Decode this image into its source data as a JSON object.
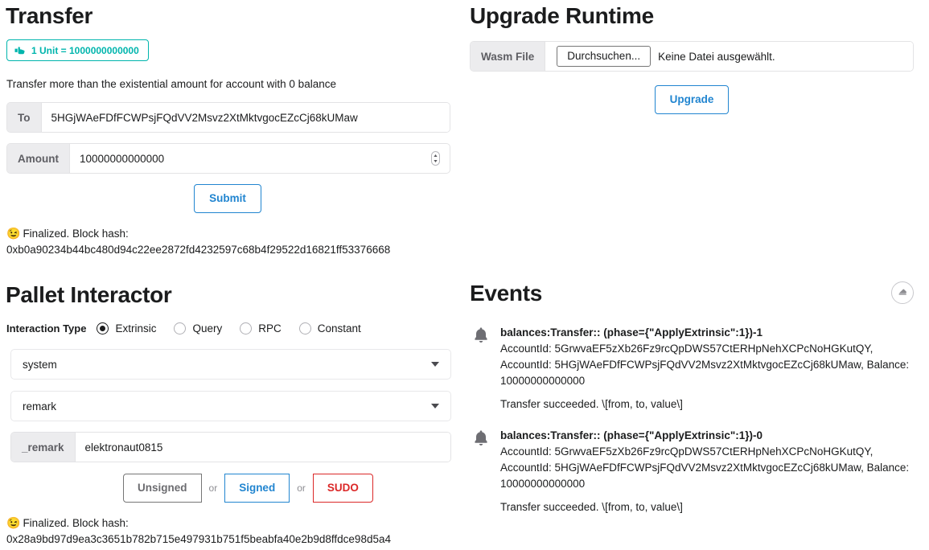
{
  "transfer": {
    "title": "Transfer",
    "unit_badge": {
      "icon": "pointing-hand-icon",
      "label": "1 Unit = 1000000000000",
      "color": "#00b5ad"
    },
    "helper_text": "Transfer more than the existential amount for account with 0 balance",
    "to_label": "To",
    "to_value": "5HGjWAeFDfFCWPsjFQdVV2Msvz2XtMktvgocEZcCj68kUMaw",
    "amount_label": "Amount",
    "amount_value": "10000000000000",
    "submit_label": "Submit",
    "status_emoji": "😉",
    "status_text": "Finalized. Block hash:",
    "status_hash": "0xb0a90234b44bc480d94c22ee2872fd4232597c68b4f29522d16821ff53376668"
  },
  "upgrade": {
    "title": "Upgrade Runtime",
    "wasm_label": "Wasm File",
    "browse_label": "Durchsuchen...",
    "file_status": "Keine Datei ausgewählt.",
    "upgrade_label": "Upgrade"
  },
  "pallet": {
    "title": "Pallet Interactor",
    "interaction_label": "Interaction Type",
    "options": [
      {
        "label": "Extrinsic",
        "checked": true
      },
      {
        "label": "Query",
        "checked": false
      },
      {
        "label": "RPC",
        "checked": false
      },
      {
        "label": "Constant",
        "checked": false
      }
    ],
    "pallet_select": "system",
    "callable_select": "remark",
    "arg_label": "_remark",
    "arg_value": "elektronaut0815",
    "unsigned_label": "Unsigned",
    "or_label_1": "or",
    "signed_label": "Signed",
    "or_label_2": "or",
    "sudo_label": "SUDO",
    "status_emoji": "😉",
    "status_text": "Finalized. Block hash:",
    "status_hash": "0x28a9bd97d9ea3c3651b782b715e497931b751f5beabfa40e2b9d8ffdce98d5a4"
  },
  "events": {
    "title": "Events",
    "clear_icon": "eraser-icon",
    "items": [
      {
        "icon": "bell-icon",
        "title": "balances:Transfer:: (phase={\"ApplyExtrinsic\":1})-1",
        "meta": "AccountId: 5GrwvaEF5zXb26Fz9rcQpDWS57CtERHpNehXCPcNoHGKutQY, AccountId: 5HGjWAeFDfFCWPsjFQdVV2Msvz2XtMktvgocEZcCj68kUMaw, Balance: 10000000000000",
        "description": "Transfer succeeded. \\[from, to, value\\]"
      },
      {
        "icon": "bell-icon",
        "title": "balances:Transfer:: (phase={\"ApplyExtrinsic\":1})-0",
        "meta": "AccountId: 5GrwvaEF5zXb26Fz9rcQpDWS57CtERHpNehXCPcNoHGKutQY, AccountId: 5HGjWAeFDfFCWPsjFQdVV2Msvz2XtMktvgocEZcCj68kUMaw, Balance: 10000000000000",
        "description": "Transfer succeeded. \\[from, to, value\\]"
      }
    ]
  }
}
